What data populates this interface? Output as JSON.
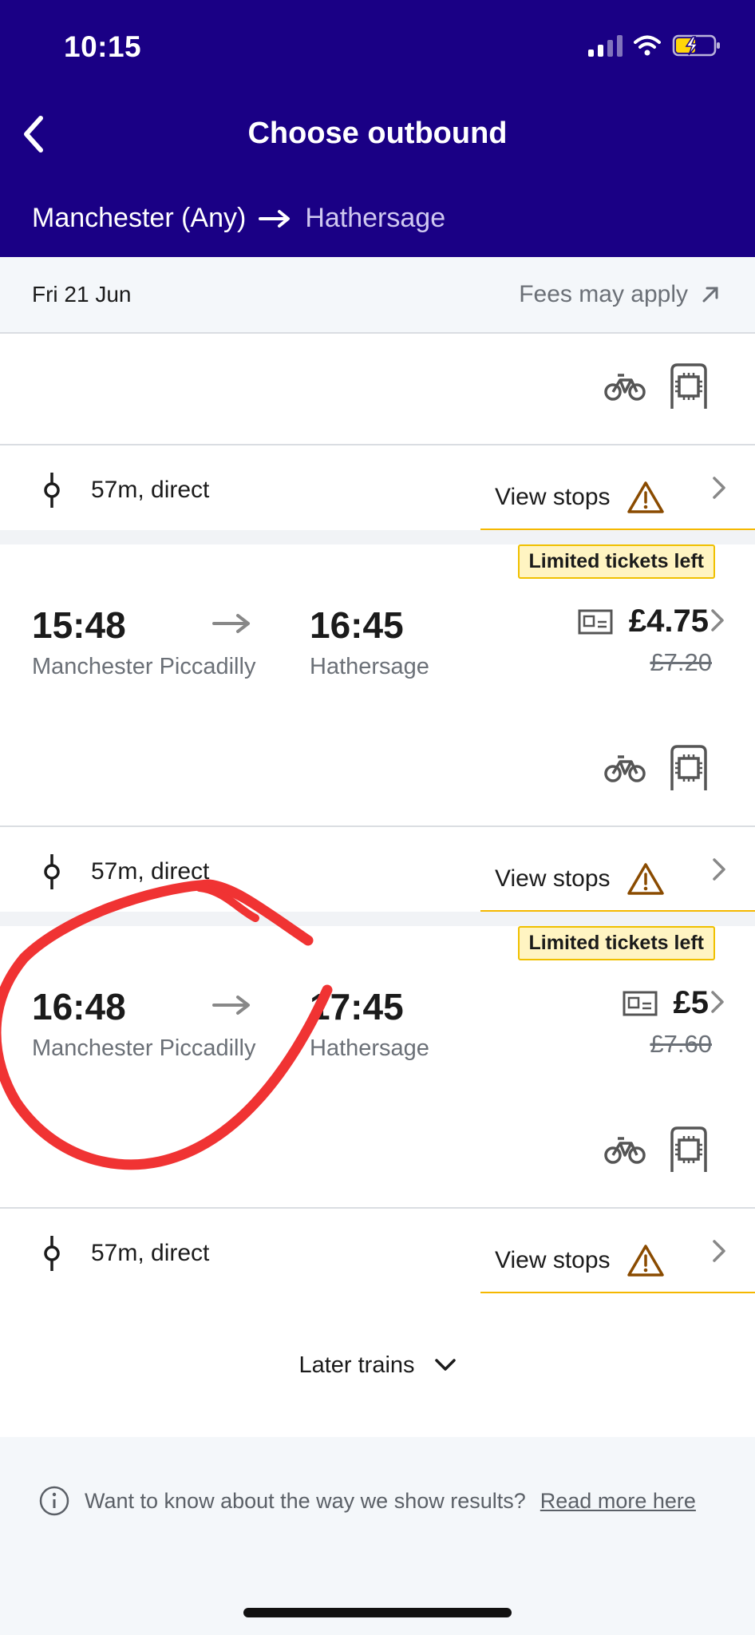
{
  "status_bar": {
    "time": "10:15"
  },
  "header": {
    "title": "Choose outbound",
    "origin": "Manchester (Any)",
    "destination": "Hathersage"
  },
  "date_bar": {
    "date": "Fri 21 Jun",
    "fees_label": "Fees may apply"
  },
  "journeys": [
    {
      "duration": "57m, direct",
      "view_stops_label": "View stops"
    },
    {
      "badge": "Limited tickets left",
      "departure_time": "15:48",
      "departure_station": "Manchester Piccadilly",
      "arrival_time": "16:45",
      "arrival_station": "Hathersage",
      "price": "£4.75",
      "original_price": "£7.20",
      "duration": "57m, direct",
      "view_stops_label": "View stops"
    },
    {
      "badge": "Limited tickets left",
      "departure_time": "16:48",
      "departure_station": "Manchester Piccadilly",
      "arrival_time": "17:45",
      "arrival_station": "Hathersage",
      "price": "£5",
      "original_price": "£7.60",
      "duration": "57m, direct",
      "view_stops_label": "View stops"
    }
  ],
  "later_trains_label": "Later trains",
  "footer": {
    "info_text": "Want to know about the way we show results?",
    "link_text": "Read more here"
  },
  "colors": {
    "header_bg": "#1a0085",
    "badge_bg": "#fff4c2",
    "accent_yellow": "#f5b800",
    "warning": "#8a4b00",
    "annotation": "#f03333"
  }
}
